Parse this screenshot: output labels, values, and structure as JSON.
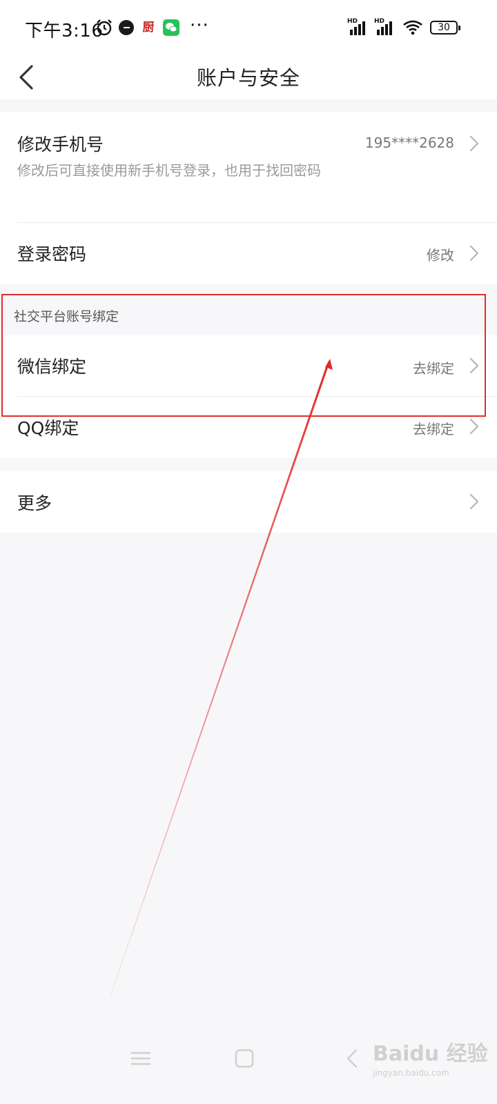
{
  "status_bar": {
    "time": "下午3:16",
    "app_char": "厨",
    "more": "···",
    "hd1": "HD",
    "hd2": "HD",
    "battery": "30"
  },
  "header": {
    "title": "账户与安全"
  },
  "account_section": {
    "phone": {
      "title": "修改手机号",
      "value": "195****2628",
      "description": "修改后可直接使用新手机号登录，也用于找回密码"
    },
    "password": {
      "title": "登录密码",
      "value": "修改"
    }
  },
  "social_section": {
    "label": "社交平台账号绑定",
    "wechat": {
      "title": "微信绑定",
      "value": "去绑定"
    },
    "qq": {
      "title": "QQ绑定",
      "value": "去绑定"
    }
  },
  "more_section": {
    "title": "更多"
  },
  "watermark": {
    "brand": "Baidu 经验",
    "url": "jingyan.baidu.com"
  },
  "colors": {
    "annotation": "#e22b2b",
    "background": "#f7f7f9",
    "card": "#ffffff",
    "secondary_text": "#9a9a9a"
  }
}
